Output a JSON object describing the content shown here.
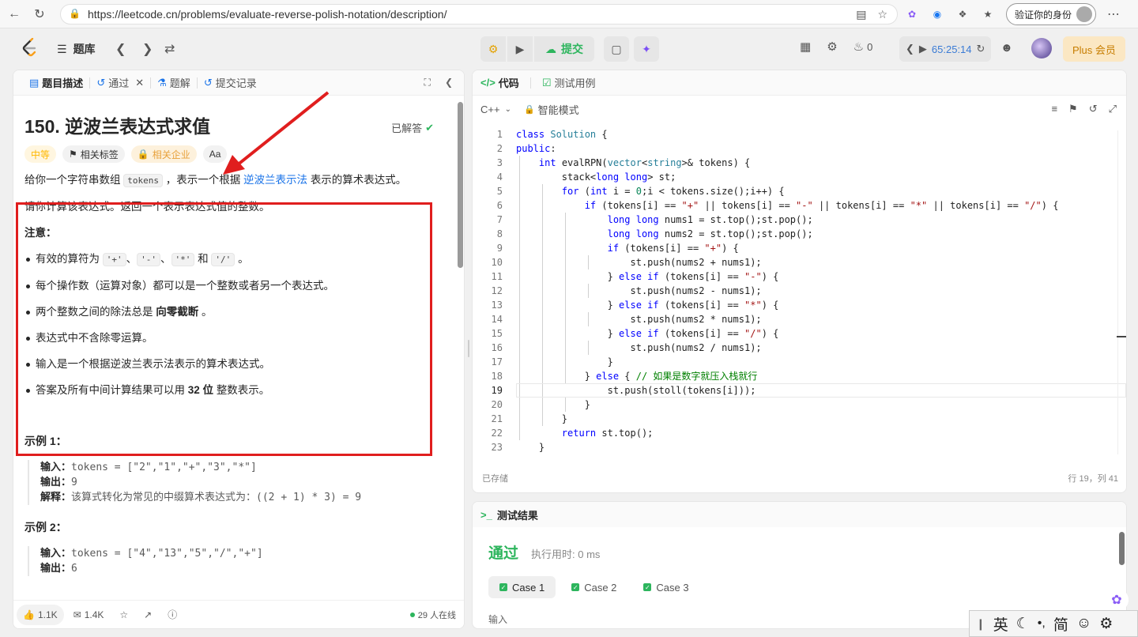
{
  "browser": {
    "url": "https://leetcode.cn/problems/evaluate-reverse-polish-notation/description/",
    "profile_label": "验证你的身份"
  },
  "appbar": {
    "tiku": "题库",
    "submit": "提交",
    "streak": "0",
    "timer": "65:25:14",
    "plus": "Plus 会员"
  },
  "left_tabs": {
    "desc": "题目描述",
    "passed": "通过",
    "solutions": "题解",
    "submissions": "提交记录"
  },
  "problem": {
    "title": "150. 逆波兰表达式求值",
    "solved": "已解答",
    "difficulty": "中等",
    "tags_label": "相关标签",
    "company_label": "相关企业",
    "font_btn": "Aa",
    "p1_a": "给你一个字符串数组",
    "p1_code": "tokens",
    "p1_b": "，表示一个根据",
    "p1_link": "逆波兰表示法",
    "p1_c": "表示的算术表达式。",
    "p2": "请你计算该表达式。返回一个表示表达式值的整数。",
    "note_title": "注意：",
    "li1_a": "有效的算符为",
    "op_plus": "'+'",
    "sep1": "、",
    "op_minus": "'-'",
    "sep2": "、",
    "op_mul": "'*'",
    "and": "和",
    "op_div": "'/'",
    "li1_end": "。",
    "li2": "每个操作数（运算对象）都可以是一个整数或者另一个表达式。",
    "li3_a": "两个整数之间的除法总是",
    "li3_b": "向零截断",
    "li3_c": "。",
    "li4": "表达式中不含除零运算。",
    "li5": "输入是一个根据逆波兰表示法表示的算术表达式。",
    "li6_a": "答案及所有中间计算结果可以用",
    "li6_b": "32 位",
    "li6_c": "整数表示。",
    "ex1_title": "示例 1：",
    "ex1_in_lbl": "输入：",
    "ex1_in": "tokens = [\"2\",\"1\",\"+\",\"3\",\"*\"]",
    "ex1_out_lbl": "输出：",
    "ex1_out": "9",
    "ex1_exp_lbl": "解释：",
    "ex1_exp_a": "该算式转化为常见的中缀算术表达式为：",
    "ex1_exp_b": "((2 + 1) * 3) = 9",
    "ex2_title": "示例 2：",
    "ex2_in_lbl": "输入：",
    "ex2_in": "tokens = [\"4\",\"13\",\"5\",\"/\",\"+\"]",
    "ex2_out_lbl": "输出：",
    "ex2_out": "6"
  },
  "left_footer": {
    "likes": "1.1K",
    "comments": "1.4K",
    "online": "29 人在线"
  },
  "editor": {
    "tab_code": "代码",
    "tab_tests": "测试用例",
    "language": "C++",
    "mode": "智能模式",
    "saved": "已存储",
    "position": "行 19，列 41",
    "lines": [
      "1",
      "2",
      "3",
      "4",
      "5",
      "6",
      "7",
      "8",
      "9",
      "10",
      "11",
      "12",
      "13",
      "14",
      "15",
      "16",
      "17",
      "18",
      "19",
      "20",
      "21",
      "22",
      "23"
    ]
  },
  "result": {
    "tab": "测试结果",
    "status": "通过",
    "runtime": "执行用时: 0 ms",
    "cases": [
      "Case 1",
      "Case 2",
      "Case 3"
    ],
    "input_label": "输入"
  },
  "ime": {
    "lang": "英",
    "simp": "简"
  },
  "colors": {
    "accent_green": "#2db55d",
    "annotation_red": "#e01e1e",
    "link_blue": "#1a73e8",
    "timer_blue": "#3a7bd5"
  }
}
